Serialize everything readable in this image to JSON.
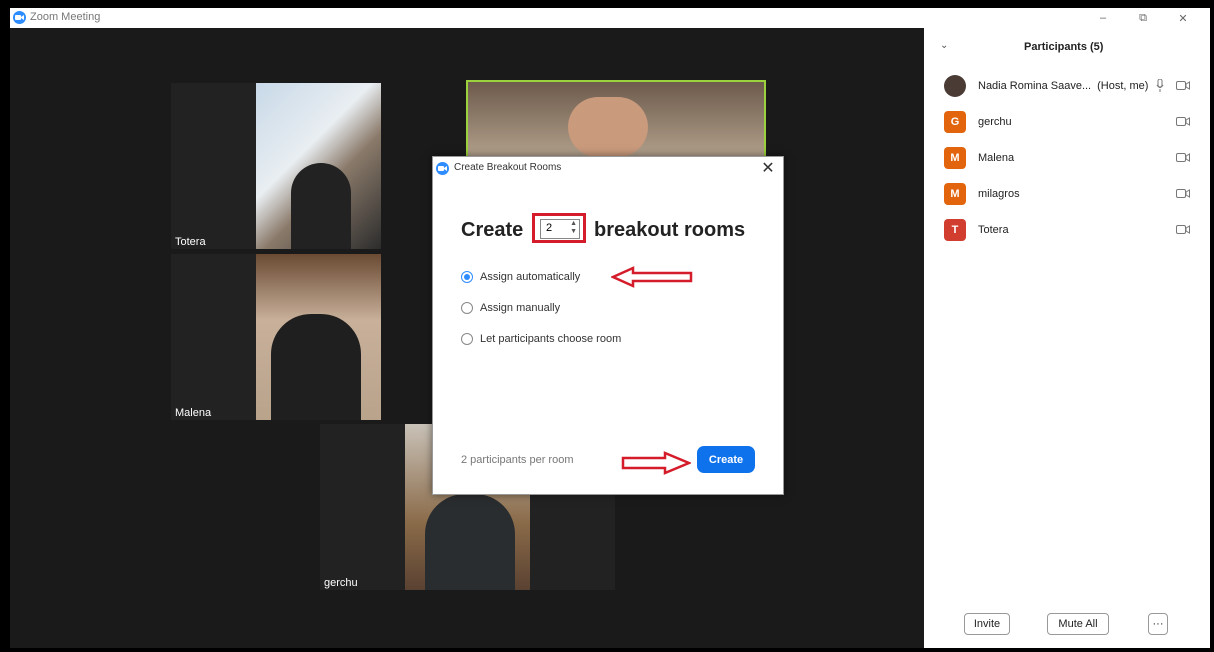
{
  "window": {
    "title": "Zoom Meeting",
    "minimize": "–",
    "restore": "⧉",
    "close": "✕"
  },
  "tiles": [
    {
      "name": "Totera"
    },
    {
      "name": "Malena"
    },
    {
      "name": "gerchu"
    }
  ],
  "dialog": {
    "title": "Create Breakout Rooms",
    "close": "✕",
    "create_word": "Create",
    "rooms_word": "breakout rooms",
    "room_count": "2",
    "options": [
      {
        "label": "Assign automatically",
        "selected": true
      },
      {
        "label": "Assign manually",
        "selected": false
      },
      {
        "label": "Let participants choose room",
        "selected": false
      }
    ],
    "per_room": "2 participants per room",
    "create_button": "Create"
  },
  "participants": {
    "title": "Participants (5)",
    "collapse": "⌄",
    "list": [
      {
        "name": "Nadia Romina Saave...",
        "role": "(Host, me)",
        "initial": "",
        "color": "#4a3b35",
        "mic": true
      },
      {
        "name": "gerchu",
        "role": "",
        "initial": "G",
        "color": "#e2650d",
        "mic": false
      },
      {
        "name": "Malena",
        "role": "",
        "initial": "M",
        "color": "#e2650d",
        "mic": false
      },
      {
        "name": "milagros",
        "role": "",
        "initial": "M",
        "color": "#e2650d",
        "mic": false
      },
      {
        "name": "Totera",
        "role": "",
        "initial": "T",
        "color": "#d13d2f",
        "mic": false
      }
    ],
    "invite": "Invite",
    "mute_all": "Mute All",
    "more": "···"
  },
  "annotation_color": "#d41c2a",
  "accent": "#0e72ed"
}
